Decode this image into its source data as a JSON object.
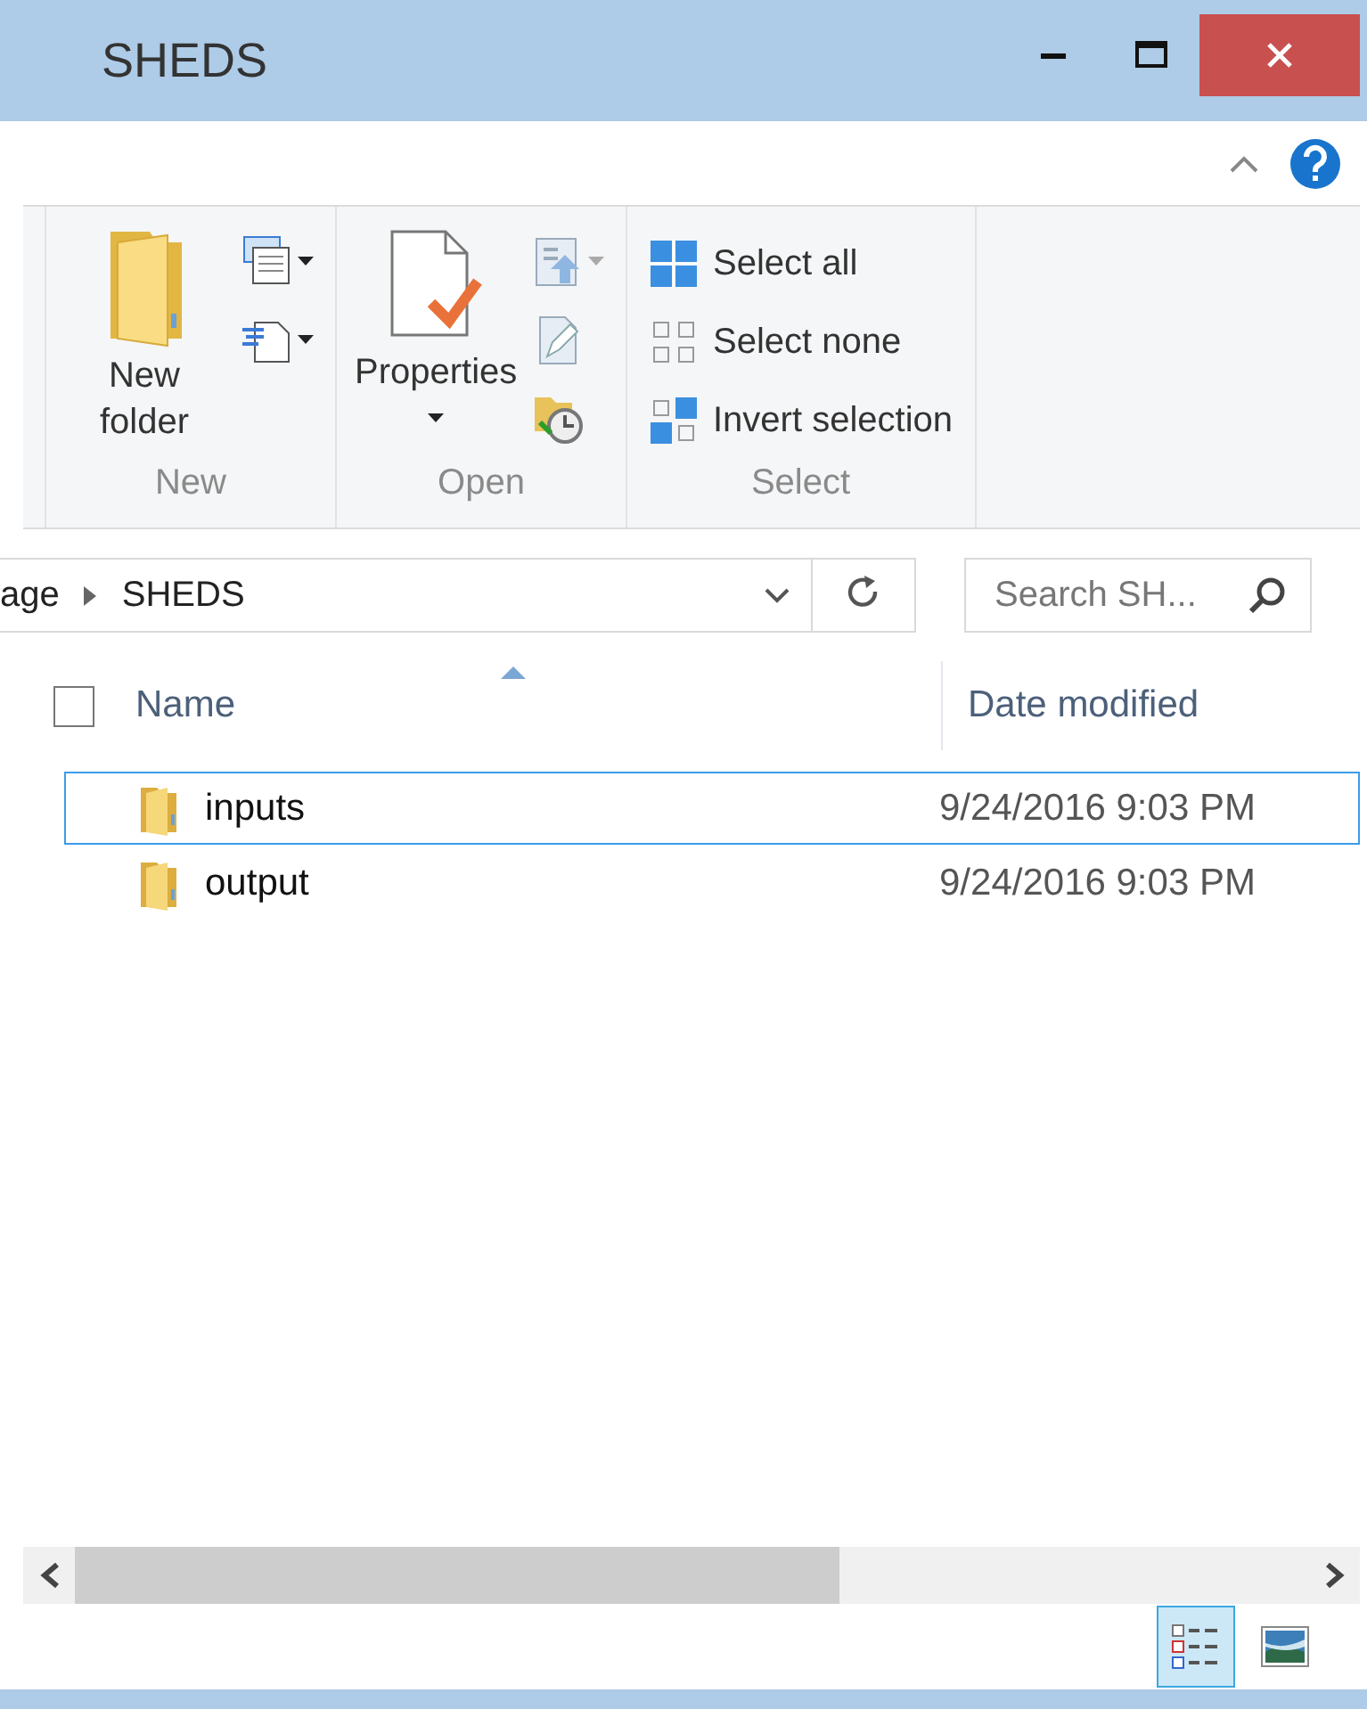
{
  "window": {
    "title": "SHEDS"
  },
  "ribbon": {
    "groups": [
      {
        "label": "New",
        "large": {
          "label": "New folder",
          "kind": "folder",
          "caret": false
        },
        "small": [
          {
            "kind": "new-item"
          },
          {
            "kind": "easy-access"
          }
        ]
      },
      {
        "label": "Open",
        "large": {
          "label": "Properties",
          "kind": "properties",
          "caret": true
        },
        "small": [
          {
            "kind": "open"
          },
          {
            "kind": "edit"
          },
          {
            "kind": "history"
          }
        ]
      },
      {
        "label": "Select",
        "items": [
          {
            "label": "Select all",
            "kind": "all"
          },
          {
            "label": "Select none",
            "kind": "none"
          },
          {
            "label": "Invert selection",
            "kind": "invert"
          }
        ]
      }
    ]
  },
  "address": {
    "path": [
      "age",
      "SHEDS"
    ]
  },
  "search": {
    "placeholder": "Search SH..."
  },
  "columns": [
    {
      "label": "Name",
      "sorted": true
    },
    {
      "label": "Date modified",
      "sorted": false
    }
  ],
  "select_all": {
    "checked": false
  },
  "rows": [
    {
      "name": "inputs",
      "date": "9/24/2016 9:03 PM",
      "selected": true
    },
    {
      "name": "output",
      "date": "9/24/2016 9:03 PM",
      "selected": false
    }
  ],
  "views": [
    {
      "kind": "details",
      "selected": true
    },
    {
      "kind": "thumbnails",
      "selected": false
    }
  ]
}
